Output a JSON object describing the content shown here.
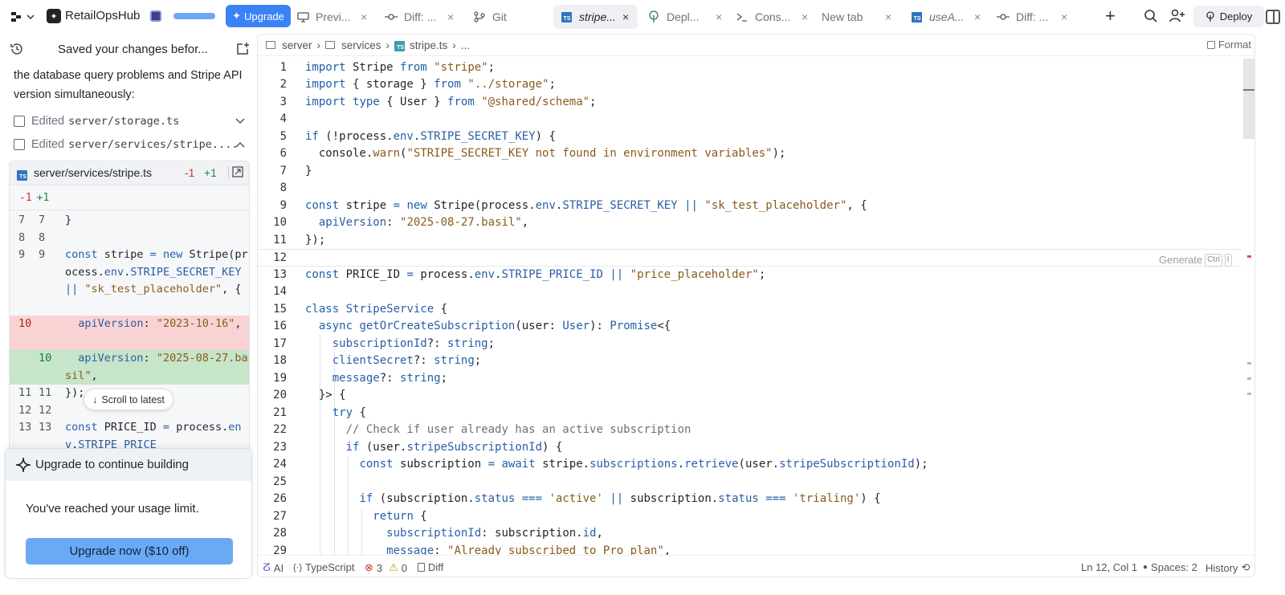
{
  "topbar": {
    "app_name": "RetailOpsHub",
    "upgrade_label": "Upgrade",
    "tabs": [
      {
        "label": "Previ...",
        "icon": "monitor-icon"
      },
      {
        "label": "Diff: ...",
        "icon": "commit-icon"
      },
      {
        "label": "Git",
        "icon": "git-branch-icon"
      },
      {
        "label": "stripe...",
        "icon": "typescript-icon",
        "active": true
      },
      {
        "label": "Depl...",
        "icon": "deploy-icon"
      },
      {
        "label": "Cons...",
        "icon": "terminal-icon"
      },
      {
        "label": "New tab",
        "icon": ""
      },
      {
        "label": "useA...",
        "icon": "typescript-icon"
      },
      {
        "label": "Diff: ...",
        "icon": "commit-icon"
      }
    ],
    "deploy_label": "Deploy"
  },
  "chat": {
    "title": "Saved your changes befor...",
    "message": "the database query problems and Stripe API version simultaneously:",
    "edited": [
      {
        "prefix": "Edited",
        "path": "server/storage.ts"
      },
      {
        "prefix": "Edited",
        "path": "server/services/stripe...."
      }
    ],
    "diff": {
      "file": "server/services/stripe.ts",
      "minus": "-1",
      "plus": "+1",
      "counts_minus": "-1",
      "counts_plus": "+1"
    },
    "scroll_latest": "Scroll to latest",
    "upgrade_card": {
      "title": "Upgrade to continue building",
      "message": "You've reached your usage limit.",
      "button": "Upgrade now ($10 off)"
    }
  },
  "editor": {
    "breadcrumb": [
      "server",
      "services",
      "stripe.ts",
      "..."
    ],
    "format_label": "Format",
    "generate_hint": "Generate",
    "generate_kbd": [
      "Ctrl",
      "I"
    ],
    "status": {
      "ai": "AI",
      "language": "TypeScript",
      "errors": "3",
      "warnings": "0",
      "diff": "Diff",
      "position": "Ln 12, Col 1",
      "spaces": "Spaces: 2",
      "history": "History"
    }
  },
  "colors": {
    "accent": "#3b82f6",
    "diff_deleted_bg": "#f9d3d3",
    "diff_added_bg": "#c6e5c9",
    "error": "#d0352c"
  }
}
